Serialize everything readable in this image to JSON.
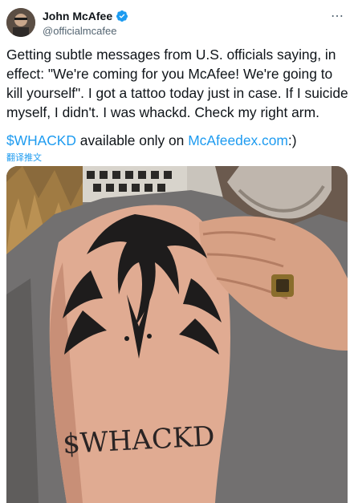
{
  "tweet": {
    "author_name": "John McAfee",
    "handle": "@officialmcafee",
    "text_lines": [
      "Getting subtle messages from U.S. officials saying, in",
      "effect: \"We're coming for you McAfee! We're going to",
      "kill yourself\". I got a tattoo today just in case. If I suicide",
      "myself, I didn't. I was whackd. Check my right arm."
    ],
    "cashtag": "$WHACKD",
    "link_middle": " available only on ",
    "link_url": "McAfeedex.com",
    "link_suffix": ":)",
    "translate_label": "翻译推文",
    "tattoo_text": "$WHACKD"
  },
  "colors": {
    "accent": "#1d9bf0",
    "text": "#0f1419",
    "secondary": "#536471"
  },
  "icons": {
    "verified": "verified-badge-icon",
    "more": "more-options-icon"
  }
}
